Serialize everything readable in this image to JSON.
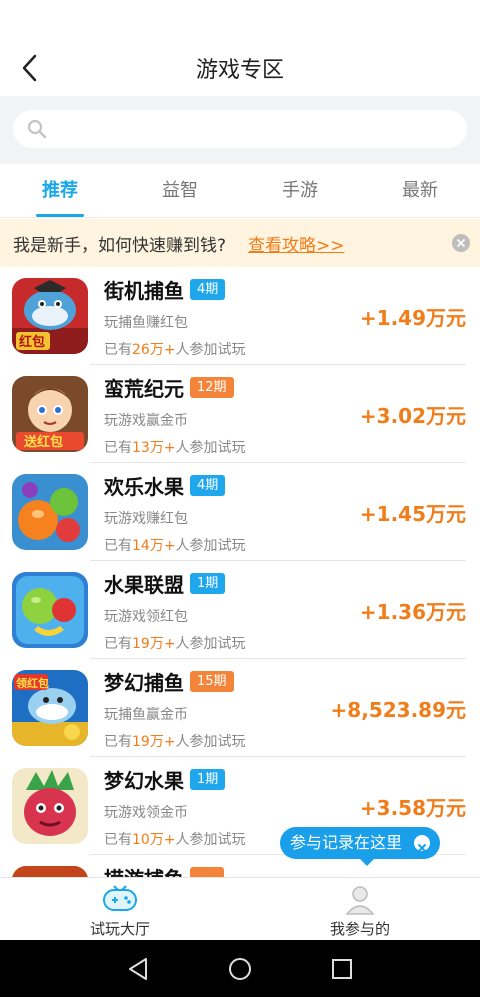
{
  "header": {
    "title": "游戏专区"
  },
  "search": {
    "placeholder": ""
  },
  "tabs": [
    {
      "label": "推荐",
      "active": true
    },
    {
      "label": "益智",
      "active": false
    },
    {
      "label": "手游",
      "active": false
    },
    {
      "label": "最新",
      "active": false
    }
  ],
  "notice": {
    "text": "我是新手，如何快速赚到钱?",
    "link": "查看攻略>>"
  },
  "games": [
    {
      "name": "街机捕鱼",
      "period": "4期",
      "badge_color": "blue",
      "desc": "玩捕鱼赚红包",
      "joined_prefix": "已有",
      "joined_count": "26万+",
      "joined_suffix": "人参加试玩",
      "reward": "+1.49万元",
      "icon": "fish-game-icon"
    },
    {
      "name": "蛮荒纪元",
      "period": "12期",
      "badge_color": "orange",
      "desc": "玩游戏赢金币",
      "joined_prefix": "已有",
      "joined_count": "13万+",
      "joined_suffix": "人参加试玩",
      "reward": "+3.02万元",
      "icon": "warrior-game-icon"
    },
    {
      "name": "欢乐水果",
      "period": "4期",
      "badge_color": "blue",
      "desc": "玩游戏赚红包",
      "joined_prefix": "已有",
      "joined_count": "14万+",
      "joined_suffix": "人参加试玩",
      "reward": "+1.45万元",
      "icon": "fruit-game-icon"
    },
    {
      "name": "水果联盟",
      "period": "1期",
      "badge_color": "blue",
      "desc": "玩游戏领红包",
      "joined_prefix": "已有",
      "joined_count": "19万+",
      "joined_suffix": "人参加试玩",
      "reward": "+1.36万元",
      "icon": "fruit-league-icon"
    },
    {
      "name": "梦幻捕鱼",
      "period": "15期",
      "badge_color": "orange",
      "desc": "玩捕鱼赢金币",
      "joined_prefix": "已有",
      "joined_count": "19万+",
      "joined_suffix": "人参加试玩",
      "reward": "+8,523.89元",
      "icon": "shark-game-icon"
    },
    {
      "name": "梦幻水果",
      "period": "1期",
      "badge_color": "blue",
      "desc": "玩游戏领金币",
      "joined_prefix": "已有",
      "joined_count": "10万+",
      "joined_suffix": "人参加试玩",
      "reward": "+3.58万元",
      "icon": "dragonfruit-game-icon"
    },
    {
      "name": "捞游捕鱼",
      "period": "",
      "badge_color": "orange",
      "desc": "",
      "joined_prefix": "",
      "joined_count": "",
      "joined_suffix": "",
      "reward": "",
      "icon": "partial-game-icon"
    }
  ],
  "tooltip": {
    "text": "参与记录在这里"
  },
  "tabbar": [
    {
      "label": "试玩大厅",
      "icon": "gamepad-icon"
    },
    {
      "label": "我参与的",
      "icon": "user-icon"
    }
  ],
  "colors": {
    "accent": "#1aa7e8",
    "reward": "#f07d1a",
    "badge_blue": "#1fa7ee",
    "badge_orange": "#f5843b"
  }
}
